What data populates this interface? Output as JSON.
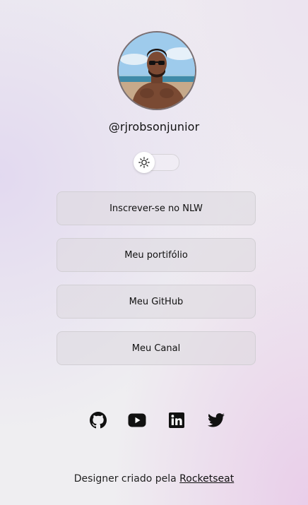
{
  "profile": {
    "username": "@rjrobsonjunior",
    "avatar_icon": "profile-photo"
  },
  "theme_switch": {
    "icon": "sun-icon",
    "state": "light"
  },
  "links": [
    {
      "label": "Inscrever-se no NLW"
    },
    {
      "label": "Meu portifólio"
    },
    {
      "label": "Meu GitHub"
    },
    {
      "label": "Meu Canal"
    }
  ],
  "social": [
    {
      "icon": "github-icon"
    },
    {
      "icon": "youtube-icon"
    },
    {
      "icon": "linkedin-icon"
    },
    {
      "icon": "twitter-icon"
    }
  ],
  "footer": {
    "text": "Designer criado pela",
    "link": "Rocketseat"
  },
  "colors": {
    "background": "#efeef1",
    "button_bg": "#dcd9df",
    "button_border": "#d2cfd4",
    "text": "#111111"
  }
}
